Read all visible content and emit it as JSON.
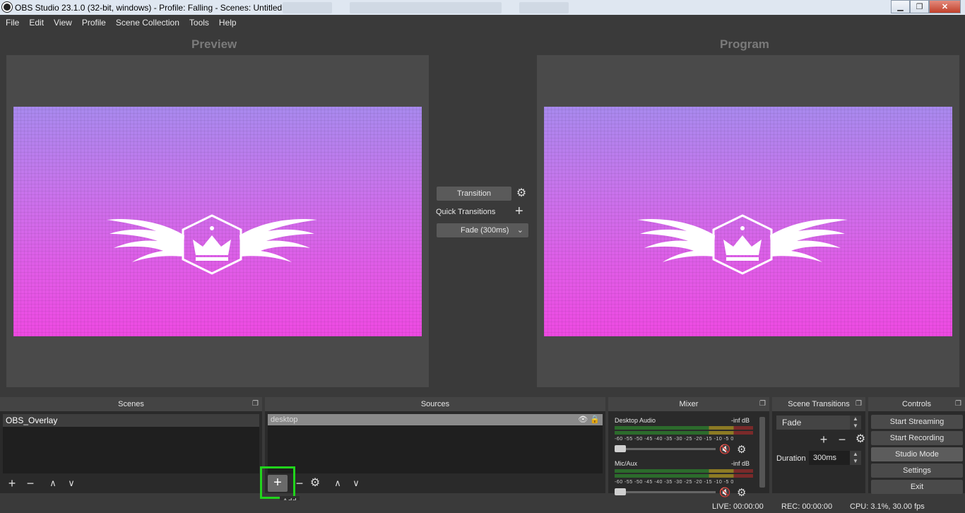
{
  "window": {
    "title": "OBS Studio 23.1.0 (32-bit, windows) - Profile: Falling - Scenes: Untitled",
    "minimize": "▁",
    "maximize": "❐",
    "close": "✕"
  },
  "menu": [
    "File",
    "Edit",
    "View",
    "Profile",
    "Scene Collection",
    "Tools",
    "Help"
  ],
  "preview": {
    "label": "Preview"
  },
  "program": {
    "label": "Program"
  },
  "transition": {
    "button_label": "Transition",
    "quick_transitions_label": "Quick Transitions",
    "fade_label": "Fade (300ms)"
  },
  "scenes": {
    "title": "Scenes",
    "items": [
      "OBS_Overlay"
    ]
  },
  "sources": {
    "title": "Sources",
    "items": [
      "desktop"
    ],
    "add_tooltip": "Add"
  },
  "mixer": {
    "title": "Mixer",
    "channels": [
      {
        "name": "Desktop Audio",
        "level": "-inf dB"
      },
      {
        "name": "Mic/Aux",
        "level": "-inf dB"
      }
    ],
    "ticks": "-60 -55 -50 -45 -40 -35 -30 -25 -20 -15 -10 -5 0"
  },
  "scene_transitions": {
    "title": "Scene Transitions",
    "selected": "Fade",
    "duration_label": "Duration",
    "duration_value": "300ms"
  },
  "controls": {
    "title": "Controls",
    "buttons": [
      "Start Streaming",
      "Start Recording",
      "Studio Mode",
      "Settings",
      "Exit"
    ]
  },
  "status": {
    "live": "LIVE: 00:00:00",
    "rec": "REC: 00:00:00",
    "cpu": "CPU: 3.1%, 30.00 fps"
  },
  "colors": {
    "accent_highlight": "#21d41c",
    "canvas_top": "#a889ee",
    "canvas_bottom": "#ee4ae2"
  }
}
